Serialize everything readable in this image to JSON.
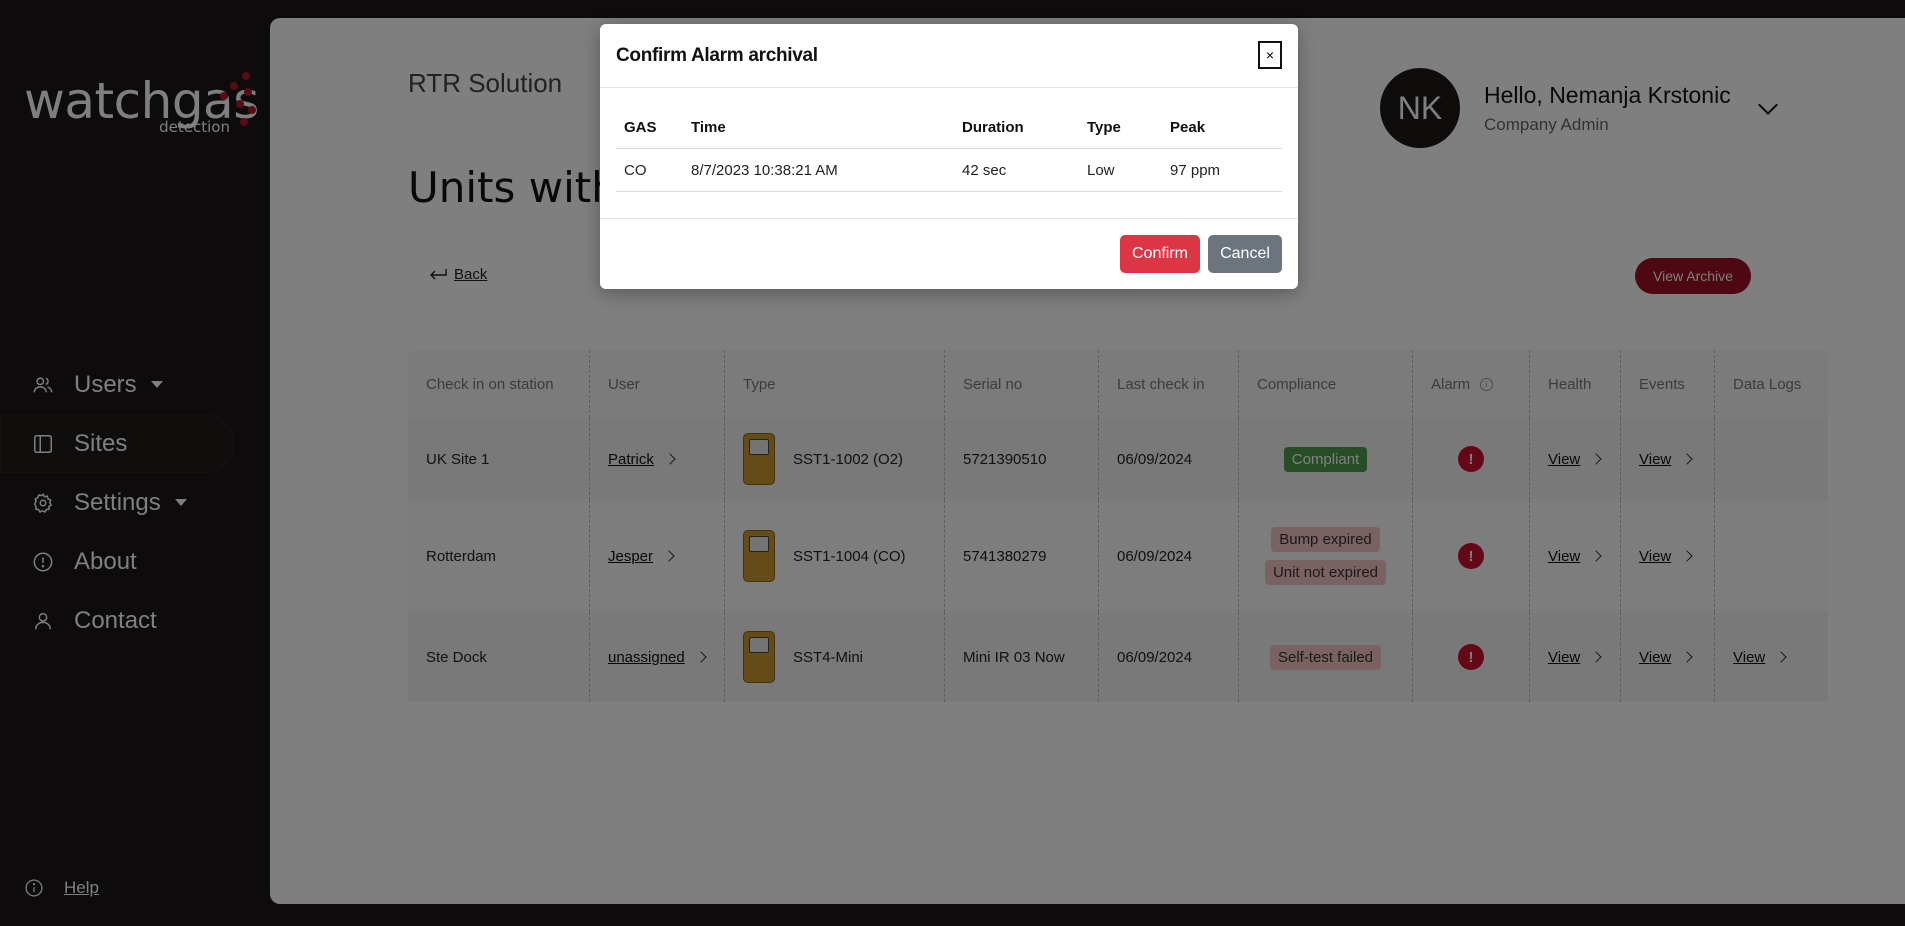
{
  "brand": {
    "word": "watchgas",
    "sub": "detection",
    "accent": "#b5182b"
  },
  "sidebar": {
    "items": [
      {
        "label": "Users",
        "icon": "users-icon",
        "has_dropdown": true
      },
      {
        "label": "Sites",
        "icon": "sidebar-panel-icon",
        "active": true
      },
      {
        "label": "Settings",
        "icon": "gear-icon",
        "has_dropdown": true
      },
      {
        "label": "About",
        "icon": "info-icon"
      },
      {
        "label": "Contact",
        "icon": "person-icon"
      }
    ],
    "help_label": "Help"
  },
  "header": {
    "company": "RTR Solution",
    "page_title": "Units with alarms",
    "user_initials": "NK",
    "user_greeting": "Hello, Nemanja Krstonic",
    "user_role": "Company Admin"
  },
  "actions": {
    "back_label": "Back",
    "view_archive_label": "View Archive"
  },
  "units_table": {
    "columns": [
      "Check in on station",
      "User",
      "Type",
      "Serial no",
      "Last check in",
      "Compliance",
      "Alarm",
      "Health",
      "Events",
      "Data Logs"
    ],
    "rows": [
      {
        "station": "UK Site 1",
        "user": "Patrick",
        "type": "SST1-1002 (O2)",
        "serial": "5721390510",
        "last_check_in": "06/09/2024",
        "compliance": [
          "Compliant"
        ],
        "alarm": "!",
        "health": "View",
        "events": "View",
        "data_logs": ""
      },
      {
        "station": "Rotterdam",
        "user": "Jesper",
        "type": "SST1-1004 (CO)",
        "serial": "5741380279",
        "last_check_in": "06/09/2024",
        "compliance": [
          "Bump expired",
          "Unit not expired"
        ],
        "alarm": "!",
        "health": "View",
        "events": "View",
        "data_logs": ""
      },
      {
        "station": "Ste Dock",
        "user": "unassigned",
        "type": "SST4-Mini",
        "serial": "Mini IR 03 Now",
        "last_check_in": "06/09/2024",
        "compliance": [
          "Self-test failed"
        ],
        "alarm": "!",
        "health": "View",
        "events": "View",
        "data_logs": "View"
      }
    ]
  },
  "modal": {
    "title": "Confirm Alarm archival",
    "close_label": "×",
    "columns": [
      "GAS",
      "Time",
      "Duration",
      "Type",
      "Peak"
    ],
    "rows": [
      {
        "gas": "CO",
        "time": "8/7/2023 10:38:21 AM",
        "duration": "42 sec",
        "type": "Low",
        "peak": "97 ppm"
      }
    ],
    "confirm_label": "Confirm",
    "cancel_label": "Cancel"
  },
  "colors": {
    "sidebar_bg": "#1a1716",
    "confirm": "#dc3545",
    "cancel": "#6c757d",
    "view_archive": "#9a1022",
    "compliant": "#4e9a4a",
    "noncompliant": "#f6c4c4",
    "alarm": "#c8102e"
  }
}
